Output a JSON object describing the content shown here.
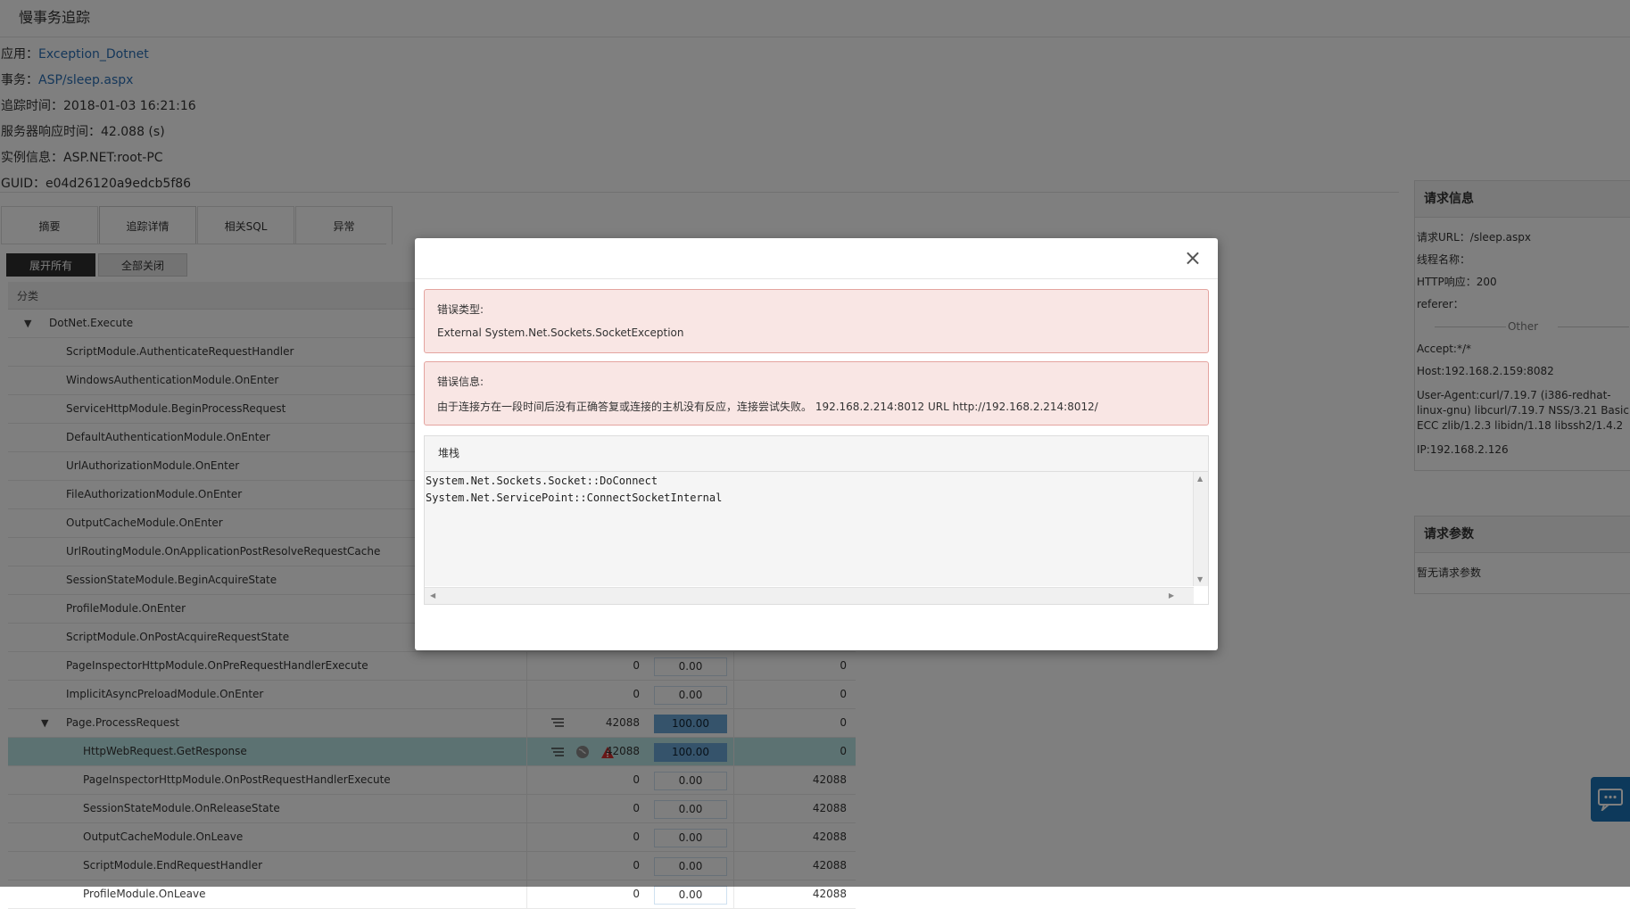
{
  "page": {
    "title": "慢事务追踪"
  },
  "info": {
    "app_label": "应用：",
    "app_value": "Exception_Dotnet",
    "txn_label": "事务：",
    "txn_value": "ASP/sleep.aspx",
    "trace_time": "追踪时间：2018-01-03 16:21:16",
    "response_time": "服务器响应时间：42.088 (s)",
    "instance": "实例信息：ASP.NET:root-PC",
    "guid": "GUID：e04d26120a9edcb5f86"
  },
  "tabs": [
    {
      "label": "摘要"
    },
    {
      "label": "追踪详情"
    },
    {
      "label": "相关SQL"
    },
    {
      "label": "异常"
    }
  ],
  "buttons": {
    "expand_all": "展开所有",
    "collapse_all": "全部关闭"
  },
  "table": {
    "header": "分类",
    "rows": [
      {
        "name": "DotNet.Execute",
        "toggle": "▼"
      },
      {
        "name": "ScriptModule.AuthenticateRequestHandler"
      },
      {
        "name": "WindowsAuthenticationModule.OnEnter"
      },
      {
        "name": "ServiceHttpModule.BeginProcessRequest"
      },
      {
        "name": "DefaultAuthenticationModule.OnEnter"
      },
      {
        "name": "UrlAuthorizationModule.OnEnter"
      },
      {
        "name": "FileAuthorizationModule.OnEnter"
      },
      {
        "name": "OutputCacheModule.OnEnter"
      },
      {
        "name": "UrlRoutingModule.OnApplicationPostResolveRequestCache"
      },
      {
        "name": "SessionStateModule.BeginAcquireState"
      },
      {
        "name": "ProfileModule.OnEnter"
      },
      {
        "name": "ScriptModule.OnPostAcquireRequestState"
      },
      {
        "name": "PageInspectorHttpModule.OnPreRequestHandlerExecute",
        "dur": "0",
        "pct": "0.00",
        "v3": "0"
      },
      {
        "name": "ImplicitAsyncPreloadModule.OnEnter",
        "dur": "0",
        "pct": "0.00",
        "v3": "0"
      },
      {
        "name": "Page.ProcessRequest",
        "toggle": "▼",
        "dur": "42088",
        "pct": "100.00",
        "v3": "0"
      },
      {
        "name": "HttpWebRequest.GetResponse",
        "dur": "42088",
        "pct": "100.00",
        "v3": "0"
      },
      {
        "name": "PageInspectorHttpModule.OnPostRequestHandlerExecute",
        "dur": "0",
        "pct": "0.00",
        "v3": "42088"
      },
      {
        "name": "SessionStateModule.OnReleaseState",
        "dur": "0",
        "pct": "0.00",
        "v3": "42088"
      },
      {
        "name": "OutputCacheModule.OnLeave",
        "dur": "0",
        "pct": "0.00",
        "v3": "42088"
      },
      {
        "name": "ScriptModule.EndRequestHandler",
        "dur": "0",
        "pct": "0.00",
        "v3": "42088"
      },
      {
        "name": "ProfileModule.OnLeave",
        "dur": "0",
        "pct": "0.00",
        "v3": "42088"
      }
    ]
  },
  "request_info": {
    "title": "请求信息",
    "url": "请求URL：/sleep.aspx",
    "thread": "线程名称：",
    "http": "HTTP响应：200",
    "referer": "referer：",
    "other": "Other",
    "accept": "Accept:*/*",
    "host": "Host:192.168.2.159:8082",
    "user_agent": "User-Agent:curl/7.19.7 (i386-redhat-linux-gnu) libcurl/7.19.7 NSS/3.21 Basic ECC zlib/1.2.3 libidn/1.18 libssh2/1.4.2",
    "ip": "IP:192.168.2.126"
  },
  "request_params": {
    "title": "请求参数",
    "empty": "暂无请求参数"
  },
  "modal": {
    "error_type_label": "错误类型:",
    "error_type_value": "External System.Net.Sockets.SocketException",
    "error_msg_label": "错误信息:",
    "error_msg_value": "由于连接方在一段时间后没有正确答复或连接的主机没有反应，连接尝试失败。 192.168.2.214:8012 URL http://192.168.2.214:8012/",
    "stack_label": "堆栈",
    "stack_lines": [
      "System.Net.Sockets.Socket::DoConnect",
      "System.Net.ServicePoint::ConnectSocketInternal"
    ],
    "close": "×"
  },
  "colors": {
    "link": "#2a6fb5",
    "progress": "#6aa7d6",
    "selected_row": "#b9e4e4",
    "error_bg": "#f9e6e4",
    "error_border": "#e4a49f",
    "chat": "#1a73b6"
  }
}
